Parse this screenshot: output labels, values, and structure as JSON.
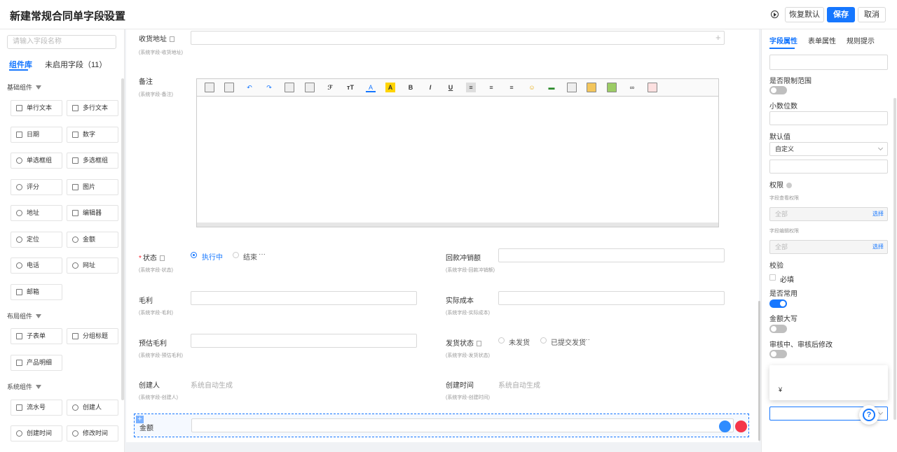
{
  "header": {
    "title": "新建常规合同单字段设置",
    "restore_label": "恢复默认",
    "save_label": "保存",
    "cancel_label": "取消"
  },
  "left": {
    "search_placeholder": "请输入字段名称",
    "tabs": [
      "组件库",
      "未启用字段（11）"
    ],
    "groups": [
      {
        "title": "基础组件",
        "items": [
          "单行文本",
          "多行文本",
          "日期",
          "数字",
          "单选框组",
          "多选框组",
          "评分",
          "图片",
          "地址",
          "编辑器",
          "定位",
          "金额",
          "电话",
          "网址",
          "邮箱"
        ]
      },
      {
        "title": "布局组件",
        "items": [
          "子表单",
          "分组标题",
          "产品明细"
        ]
      },
      {
        "title": "系统组件",
        "items": [
          "流水号",
          "创建人",
          "创建时间",
          "修改时间"
        ]
      }
    ]
  },
  "canvas": {
    "shipping_address": {
      "label": "收货地址",
      "sub": "(系统字段-收货地址)"
    },
    "remark": {
      "label": "备注",
      "sub": "(系统字段-备注)"
    },
    "status": {
      "label": "状态",
      "sub": "(系统字段-状态)",
      "options": [
        "执行中",
        "结束"
      ],
      "more": "···"
    },
    "refund": {
      "label": "回款冲销额",
      "sub": "(系统字段-回款冲销额)"
    },
    "gross": {
      "label": "毛利",
      "sub": "(系统字段-毛利)"
    },
    "actual_cost": {
      "label": "实际成本",
      "sub": "(系统字段-实际成本)"
    },
    "est_gross": {
      "label": "预估毛利",
      "sub": "(系统字段-预估毛利)"
    },
    "ship_status": {
      "label": "发货状态",
      "sub": "(系统字段-发货状态)",
      "options": [
        "未发货",
        "已提交发货"
      ],
      "more": "···"
    },
    "creator": {
      "label": "创建人",
      "sub": "(系统字段-创建人)",
      "value": "系统自动生成"
    },
    "create_time": {
      "label": "创建时间",
      "sub": "(系统字段-创建时间)",
      "value": "系统自动生成"
    },
    "amount": {
      "label": "金额"
    },
    "toolbar_icons": [
      "document-icon",
      "template-icon",
      "undo-icon",
      "redo-icon",
      "paste-icon",
      "paste-text-icon",
      "font-family-icon",
      "font-size-icon",
      "font-color-icon",
      "highlight-icon",
      "bold-icon",
      "italic-icon",
      "underline-icon",
      "align-left-icon",
      "align-center-icon",
      "align-right-icon",
      "emoji-icon",
      "horizontal-rule-icon",
      "table-icon",
      "image-icon",
      "media-icon",
      "link-icon",
      "map-icon"
    ],
    "toolbar_glyphs": {
      "font_color": "A",
      "highlight": "A",
      "bold": "B",
      "italic": "I",
      "underline": "U"
    }
  },
  "right": {
    "tabs": [
      "字段属性",
      "表单属性",
      "规则提示"
    ],
    "limit_range": "是否限制范围",
    "decimal": "小数位数",
    "default_value": "默认值",
    "default_select": "自定义",
    "permission": "权限",
    "view_perm": "字段查看权限",
    "view_perm_value": "全部",
    "edit_perm": "字段编辑权限",
    "edit_perm_value": "全部",
    "select_link": "选择",
    "validate": "校验",
    "required": "必填",
    "common": "是否常用",
    "uppercase": "金额大写",
    "review_edit": "审核中、审核后修改",
    "currency_symbol": "¥",
    "help": "?"
  }
}
